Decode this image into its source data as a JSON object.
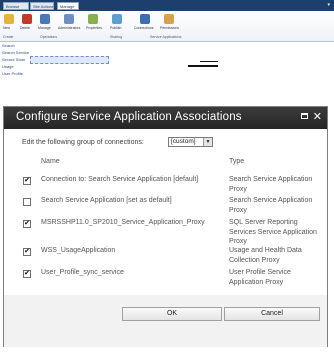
{
  "background": {
    "tabs": [
      "Browse",
      "Site Actions",
      "Manage"
    ],
    "ribbon_labels": [
      "New",
      "Delete",
      "Manage",
      "Administrators",
      "Properties",
      "Publish",
      "Connections",
      "Permissions"
    ],
    "group_labels": [
      "Create",
      "Operations",
      "Sharing",
      "Service Applications"
    ],
    "list_items": [
      "Search",
      "Search Service",
      "Secure Store",
      "Usage",
      "User Profile"
    ]
  },
  "dialog": {
    "title": "Configure Service Application Associations",
    "edit_label": "Edit the following group of connections:",
    "group_value": "[custom]",
    "headers": {
      "name": "Name",
      "type": "Type"
    },
    "rows": [
      {
        "checked": true,
        "name": "Connection to: Search Service Application [default]",
        "type": "Search Service Application Proxy"
      },
      {
        "checked": false,
        "name": "Search Service Application [set as default]",
        "type": "Search Service Application Proxy"
      },
      {
        "checked": true,
        "name": "MSRSSHP11.0_SP2010_Service_Application_Proxy",
        "type": "SQL Server Reporting Services Service Application Proxy"
      },
      {
        "checked": true,
        "name": "WSS_UsageApplication",
        "type": "Usage and Health Data Collection Proxy"
      },
      {
        "checked": true,
        "name": "User_Profile_sync_service",
        "type": "User Profile Service Application Proxy"
      }
    ],
    "ok_label": "OK",
    "cancel_label": "Cancel",
    "check_glyph": "✔"
  }
}
